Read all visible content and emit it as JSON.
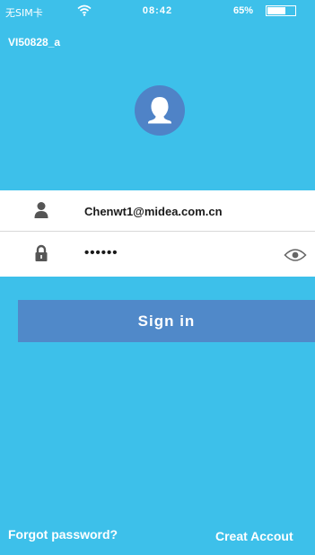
{
  "status_bar": {
    "carrier": "无SIM卡",
    "time": "08:42",
    "battery_percent": "65%",
    "battery_level": 0.65
  },
  "device_id": "VI50828_a",
  "login": {
    "username_value": "Chenwt1@midea.com.cn",
    "password_value": "••••••"
  },
  "buttons": {
    "sign_in_label": "Sign in"
  },
  "links": {
    "forgot_password": "Forgot password?",
    "create_account": "Creat Accout"
  },
  "colors": {
    "background": "#3dc0ea",
    "button": "#5089c9",
    "avatar": "#4f83c7",
    "field_bg": "#ffffff"
  },
  "icons": {
    "wifi": "wifi-icon",
    "battery": "battery-icon",
    "avatar": "user-avatar-icon",
    "user": "user-icon",
    "lock": "lock-icon",
    "eye": "eye-icon"
  }
}
